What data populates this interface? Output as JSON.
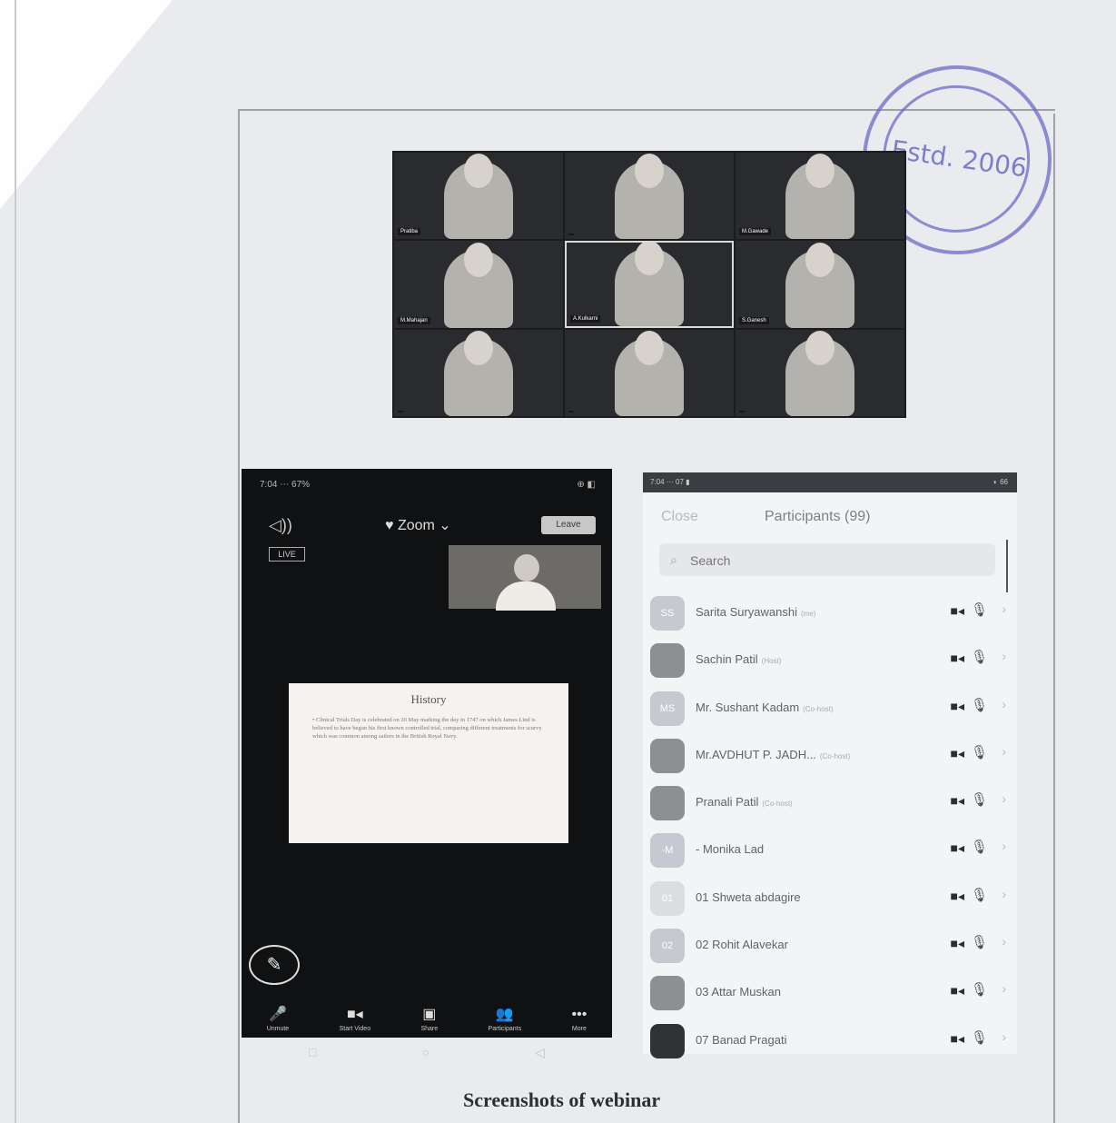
{
  "stamp": {
    "text": "Estd. 2006"
  },
  "gallery": {
    "tiles": [
      {
        "name": "Pratiba"
      },
      {
        "name": ""
      },
      {
        "name": "M.Gawade"
      },
      {
        "name": "M.Mahajan"
      },
      {
        "name": "A.Kulkarni"
      },
      {
        "name": "S.Ganesh"
      },
      {
        "name": ""
      },
      {
        "name": ""
      },
      {
        "name": ""
      }
    ]
  },
  "zoom_phone": {
    "status_time": "7:04 ⋯ 67%",
    "status_right": "⊕ ◧",
    "title": "♥ Zoom ⌄",
    "leave_label": "Leave",
    "live_badge": "LIVE",
    "slide_title": "History",
    "slide_body": "• Clinical Trials Day is celebrated on 20 May marking the day in 1747 on which James Lind is believed to have begun his first known controlled trial, comparing different treatments for scurvy which was common among sailors in the British Royal Navy.",
    "pencil_icon": "✎",
    "toolbar": [
      {
        "icon": "🎤",
        "label": "Unmute"
      },
      {
        "icon": "■◂",
        "label": "Start Video"
      },
      {
        "icon": "▣",
        "label": "Share"
      },
      {
        "icon": "👥",
        "label": "Participants"
      },
      {
        "icon": "•••",
        "label": "More"
      }
    ]
  },
  "softkeys": [
    "□",
    "○",
    "◁"
  ],
  "participants_panel": {
    "status_left": "7:04 ⋯ 07 ▮",
    "status_right": "◐ 66",
    "close_label": "Close",
    "title": "Participants (99)",
    "search_placeholder": "Search",
    "rows": [
      {
        "initials": "SS",
        "name": "Sarita Suryawanshi",
        "role": "(me)",
        "avatar": "plain"
      },
      {
        "initials": "",
        "name": "Sachin Patil",
        "role": "(Host)",
        "avatar": "photo"
      },
      {
        "initials": "MS",
        "name": "Mr. Sushant Kadam",
        "role": "(Co-host)",
        "avatar": "plain"
      },
      {
        "initials": "",
        "name": "Mr.AVDHUT P. JADH...",
        "role": "(Co-host)",
        "avatar": "photo"
      },
      {
        "initials": "",
        "name": "Pranali Patil",
        "role": "(Co-host)",
        "avatar": "photo"
      },
      {
        "initials": "-M",
        "name": "- Monika Lad",
        "role": "",
        "avatar": "plain"
      },
      {
        "initials": "01",
        "name": "01 Shweta abdagire",
        "role": "",
        "avatar": "light"
      },
      {
        "initials": "02",
        "name": "02 Rohit Alavekar",
        "role": "",
        "avatar": "plain"
      },
      {
        "initials": "",
        "name": "03 Attar Muskan",
        "role": "",
        "avatar": "photo"
      },
      {
        "initials": "",
        "name": "07 Banad Pragati",
        "role": "",
        "avatar": "dark"
      }
    ],
    "video_icon": "■◂",
    "mic_icon": "🎙",
    "chevron": "›"
  },
  "caption": "Screenshots of webinar"
}
